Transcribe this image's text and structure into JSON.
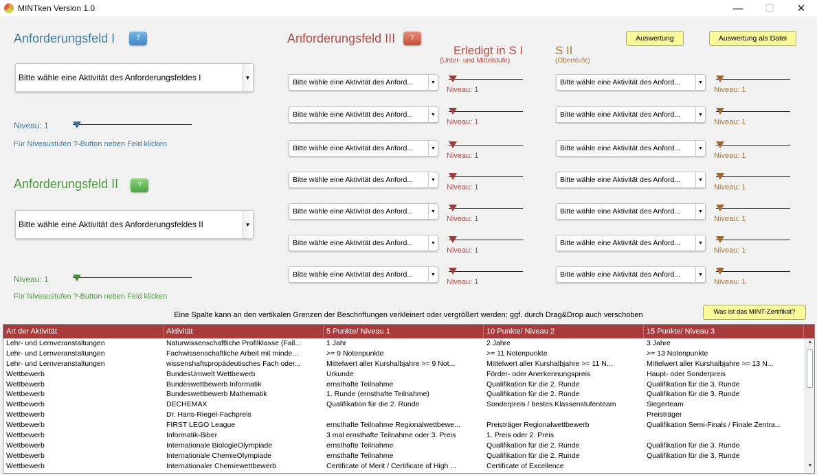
{
  "window": {
    "title": "MINTken Version 1.0",
    "minimize": "—",
    "maximize": "☐",
    "close": "✕"
  },
  "colors": {
    "field1": "#3d7aa6",
    "field2": "#4a9a3c",
    "field3": "#b44a45",
    "sii": "#a8763e",
    "table_header": "#a83c3c",
    "button_yellow": "#fafa9a"
  },
  "field1": {
    "title": "Anforderungsfeld I",
    "help_label": "?",
    "combo_value": "Bitte wähle eine Aktivität des Anforderungsfeldes I",
    "niveau": "Niveau: 1",
    "hint": "Für Niveaustufen ?-Button neben Feld klicken"
  },
  "field2": {
    "title": "Anforderungsfeld II",
    "help_label": "?",
    "combo_value": "Bitte wähle eine Aktivität des Anforderungsfeldes II",
    "niveau": "Niveau: 1",
    "hint": "Für Niveaustufen ?-Button neben Feld klicken"
  },
  "field3": {
    "title": "Anforderungsfeld III",
    "help_label": "?",
    "si_heading": "Erledigt in S I",
    "si_sub": "(Unter- und Mittelstufe)",
    "sii_heading": "S II",
    "sii_sub": "(Oberstufe)",
    "combo_value": "Bitte wähle eine Aktivität des Anford...",
    "niveau": "Niveau: 1"
  },
  "buttons": {
    "auswertung": "Auswertung",
    "auswertung_datei": "Auswertung als Datei",
    "mint_info": "Was ist das MINT-Zertifikat?"
  },
  "info_text": "Eine Spalte kann an den vertikalen Grenzen der Beschriftungen verkleinert oder vergrößert werden; ggf. durch Drag&Drop auch verschoben",
  "table": {
    "headers": [
      "Art der Aktivität",
      "Aktivität",
      "5 Punkte/ Niveau 1",
      "10 Punkte/ Niveau 2",
      "15 Punkte/ Niveau 3"
    ],
    "rows": [
      [
        "Lehr- und Lernveranstaltungen",
        "Naturwissenschaftliche Profilklasse (Fall...",
        "1 Jahr",
        "2 Jahre",
        "3 Jahre"
      ],
      [
        "Lehr- und Lernveranstaltungen",
        "Fachwissenschaftliche Arbeit mit minde...",
        ">= 9 Notenpunkte",
        ">= 11 Notenpunkte",
        ">= 13 Notenpunkte"
      ],
      [
        "Lehr- und Lernveranstaltungen",
        "wissenshaftspropädeutisches Fach oder...",
        "Mittelwert aller Kurshalbjahre >= 9 Not...",
        "Mittelwert aller Kurshalbjahre >= 11 N...",
        "Mittelwert aller Kurshalbjahre >= 13 N..."
      ],
      [
        "Wettbewerb",
        "BundesUmwelt Wettbewerb",
        "Urkunde",
        "Förder- oder Anerkennungspreis",
        "Haupt- oder Sonderpreis"
      ],
      [
        "Wettbewerb",
        "Bundeswettbewerb Informatik",
        "ernsthafte Teilnahme",
        "Qualifikation für die 2. Runde",
        "Qualifikation für die 3. Runde"
      ],
      [
        "Wettbewerb",
        "Bundeswettbewerb Mathematik",
        "1. Runde (ernsthafte Teilnahme)",
        "Qualifikation für die 2. Runde",
        "Qualifikation für die 3. Runde"
      ],
      [
        "Wettbewerb",
        "DECHEMAX",
        "Qualifikation für die 2. Runde",
        "Sonderpreis / bestes Klassenstufenteam",
        "Siegerteam"
      ],
      [
        "Wettbewerb",
        "Dr. Hans-Riegel-Fachpreis",
        "",
        "",
        "Preisträger"
      ],
      [
        "Wettbewerb",
        "FIRST LEGO League",
        "ernsthafte Teilnahme Regionalwettbewe...",
        "Preisträger Regionalwettbewerb",
        "Qualifikation Semi-Finals / Finale Zentra..."
      ],
      [
        "Wettbewerb",
        "Informatik-Biber",
        "3 mal ernsthafte Teilnahme oder 3. Preis",
        "1. Preis oder 2. Preis",
        ""
      ],
      [
        "Wettbewerb",
        "Internationale BiologieOlympiade",
        "ernsthafte Teilnahme",
        "Qualifikation für die 2. Runde",
        "Qualifikation für die 3. Runde"
      ],
      [
        "Wettbewerb",
        "Internationale ChemieOlympiade",
        "ernsthafte Teilnahme",
        "Qualifikation für die 2. Runde",
        "Qualifikation für die 3. Runde"
      ],
      [
        "Wettbewerb",
        "Internationaler Chemiewettbewerb",
        "Certificate of Merit / Certificate of High ...",
        "Certificate of Excellence",
        ""
      ]
    ]
  }
}
